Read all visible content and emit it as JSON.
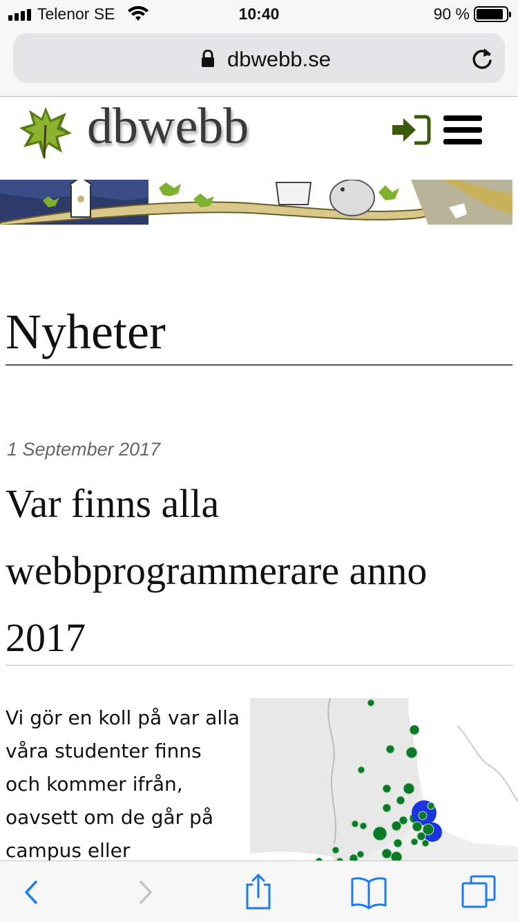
{
  "status_bar": {
    "carrier": "Telenor SE",
    "time": "10:40",
    "battery_percent": "90 %",
    "battery_level": 0.9,
    "icons": [
      "signal-icon",
      "wifi-icon",
      "battery-icon"
    ]
  },
  "browser": {
    "domain": "dbwebb.se",
    "icons": [
      "lock-icon",
      "reload-icon"
    ],
    "toolbar_icons": [
      "back-icon",
      "forward-icon",
      "share-icon",
      "bookmarks-icon",
      "tabs-icon"
    ]
  },
  "site": {
    "brand": "dbwebb",
    "icons": [
      "leaf-logo-icon",
      "login-icon",
      "hamburger-menu-icon"
    ],
    "accent_color": "#3d5a0f"
  },
  "main": {
    "page_title": "Nyheter",
    "article": {
      "date": "1 September 2017",
      "title": "Var finns alla webbprogrammerare anno 2017",
      "excerpt": "Vi gör en koll på var alla våra studenter finns och kommer ifrån, oavsett om de går på campus eller"
    }
  },
  "colors": {
    "map_point": "#0a7a2a",
    "map_cluster": "#1a35e0"
  }
}
